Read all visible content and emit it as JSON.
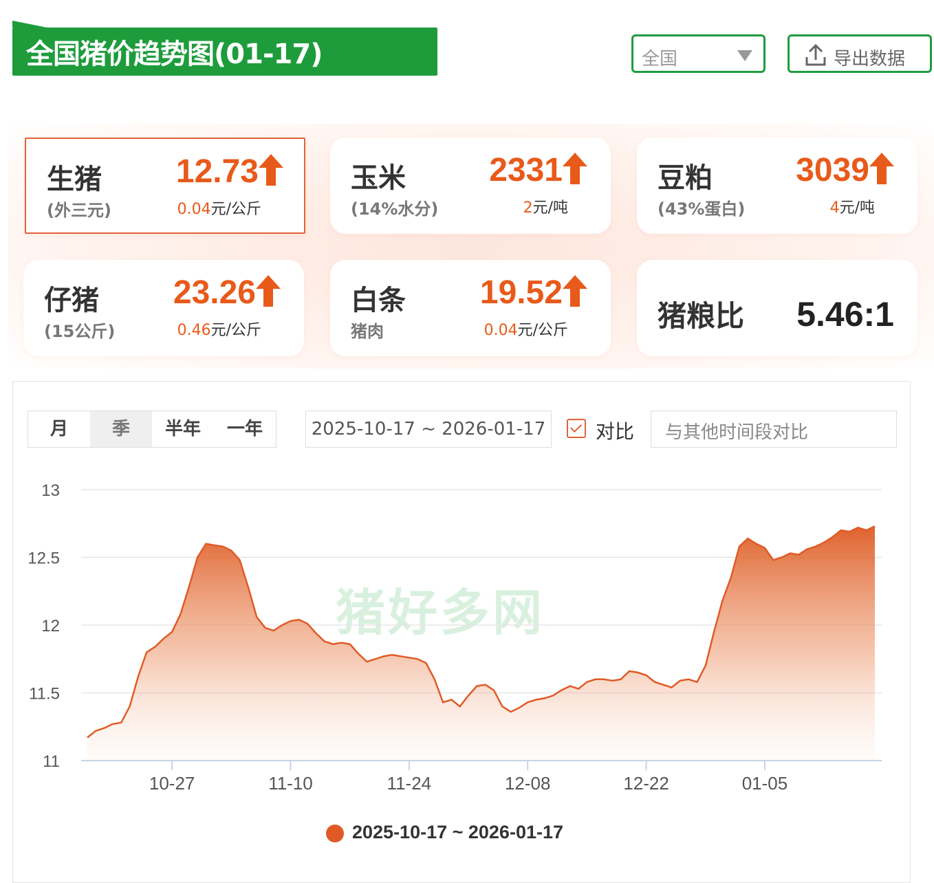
{
  "header": {
    "title": "全国猪价趋势图(01-17)",
    "region_select": "全国",
    "export_label": "导出数据"
  },
  "cards": {
    "live_pig": {
      "name": "生猪",
      "sub": "(外三元)",
      "price": "12.73",
      "change": "0.04",
      "unit": "元/公斤",
      "trend": "up"
    },
    "corn": {
      "name": "玉米",
      "sub": "(14%水分)",
      "price": "2331",
      "change": "2",
      "unit": "元/吨",
      "trend": "up"
    },
    "soymeal": {
      "name": "豆粕",
      "sub": "(43%蛋白)",
      "price": "3039",
      "change": "4",
      "unit": "元/吨",
      "trend": "up"
    },
    "piglet": {
      "name": "仔猪",
      "sub": "(15公斤)",
      "price": "23.26",
      "change": "0.46",
      "unit": "元/公斤",
      "trend": "up"
    },
    "pork": {
      "name": "白条",
      "sub": "猪肉",
      "price": "19.52",
      "change": "0.04",
      "unit": "元/公斤",
      "trend": "up"
    },
    "ratio": {
      "name": "猪粮比",
      "value": "5.46:1"
    }
  },
  "controls": {
    "tabs": [
      "月",
      "季",
      "半年",
      "一年"
    ],
    "selected_tab": "季",
    "date_range": "2025-10-17 ~ 2026-01-17",
    "compare_label": "对比",
    "compare_checked": true,
    "compare_placeholder": "与其他时间段对比"
  },
  "watermark": "猪好多网",
  "colors": {
    "accent": "#e85a1a",
    "brand_green": "#1e9c3c",
    "series": "#e05a25"
  },
  "chart_data": {
    "type": "area",
    "ylim": [
      11,
      13
    ],
    "yticks": [
      "13",
      "12.5",
      "12",
      "11.5",
      "11"
    ],
    "xticks": [
      {
        "day": 10,
        "label": "10-27"
      },
      {
        "day": 24,
        "label": "11-10"
      },
      {
        "day": 38,
        "label": "11-24"
      },
      {
        "day": 52,
        "label": "12-08"
      },
      {
        "day": 66,
        "label": "12-22"
      },
      {
        "day": 80,
        "label": "01-05"
      }
    ],
    "x_start": "2025-10-17",
    "x_end": "2026-01-17",
    "grid": true,
    "legend": "bottom",
    "series": [
      {
        "name": "2025-10-17 ~ 2026-01-17",
        "values": [
          11.17,
          11.22,
          11.24,
          11.27,
          11.28,
          11.4,
          11.62,
          11.8,
          11.84,
          11.9,
          11.95,
          12.08,
          12.28,
          12.5,
          12.6,
          12.59,
          12.58,
          12.55,
          12.48,
          12.28,
          12.06,
          11.98,
          11.96,
          12.0,
          12.03,
          12.04,
          12.01,
          11.94,
          11.88,
          11.86,
          11.87,
          11.86,
          11.79,
          11.73,
          11.75,
          11.77,
          11.78,
          11.77,
          11.76,
          11.75,
          11.72,
          11.6,
          11.43,
          11.45,
          11.4,
          11.48,
          11.55,
          11.56,
          11.52,
          11.4,
          11.36,
          11.39,
          11.43,
          11.45,
          11.46,
          11.48,
          11.52,
          11.55,
          11.53,
          11.58,
          11.6,
          11.6,
          11.59,
          11.6,
          11.66,
          11.65,
          11.63,
          11.58,
          11.56,
          11.54,
          11.59,
          11.6,
          11.58,
          11.7,
          11.95,
          12.18,
          12.35,
          12.58,
          12.64,
          12.6,
          12.57,
          12.48,
          12.5,
          12.53,
          12.52,
          12.56,
          12.58,
          12.61,
          12.65,
          12.7,
          12.69,
          12.72,
          12.7,
          12.73
        ]
      }
    ]
  }
}
